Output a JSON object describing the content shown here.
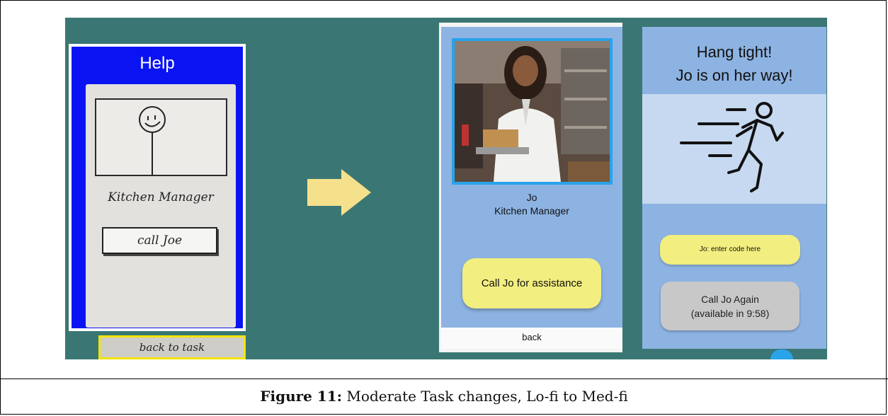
{
  "lofi": {
    "title": "Help",
    "role_label": "Kitchen Manager",
    "call_button": "call Joe",
    "back_button": "back to task"
  },
  "medfi_profile": {
    "name": "Jo",
    "role": "Kitchen Manager",
    "call_button": "Call Jo for assistance",
    "back_button": "back"
  },
  "medfi_waiting": {
    "heading_line1": "Hang tight!",
    "heading_line2": "Jo is on her way!",
    "code_button": "Jo: enter code here",
    "call_again_line1": "Call Jo Again",
    "call_again_line2": "(available in 9:58)"
  },
  "caption": {
    "label": "Figure 11:",
    "text": " Moderate Task changes, Lo-fi to Med-fi"
  },
  "colors": {
    "teal_background": "#3a7774",
    "lofi_blue": "#0a14f2",
    "medfi_blue": "#8db3e2",
    "medfi_light_blue": "#c6d9f0",
    "button_yellow": "#f2ee7f",
    "arrow_yellow": "#f5e08c",
    "highlight_yellow": "#f2e500",
    "photo_border": "#29a3ea"
  },
  "icons": {
    "transition": "arrow-right-icon",
    "running": "running-person-icon",
    "lofi_face": "smiley-face-icon"
  }
}
